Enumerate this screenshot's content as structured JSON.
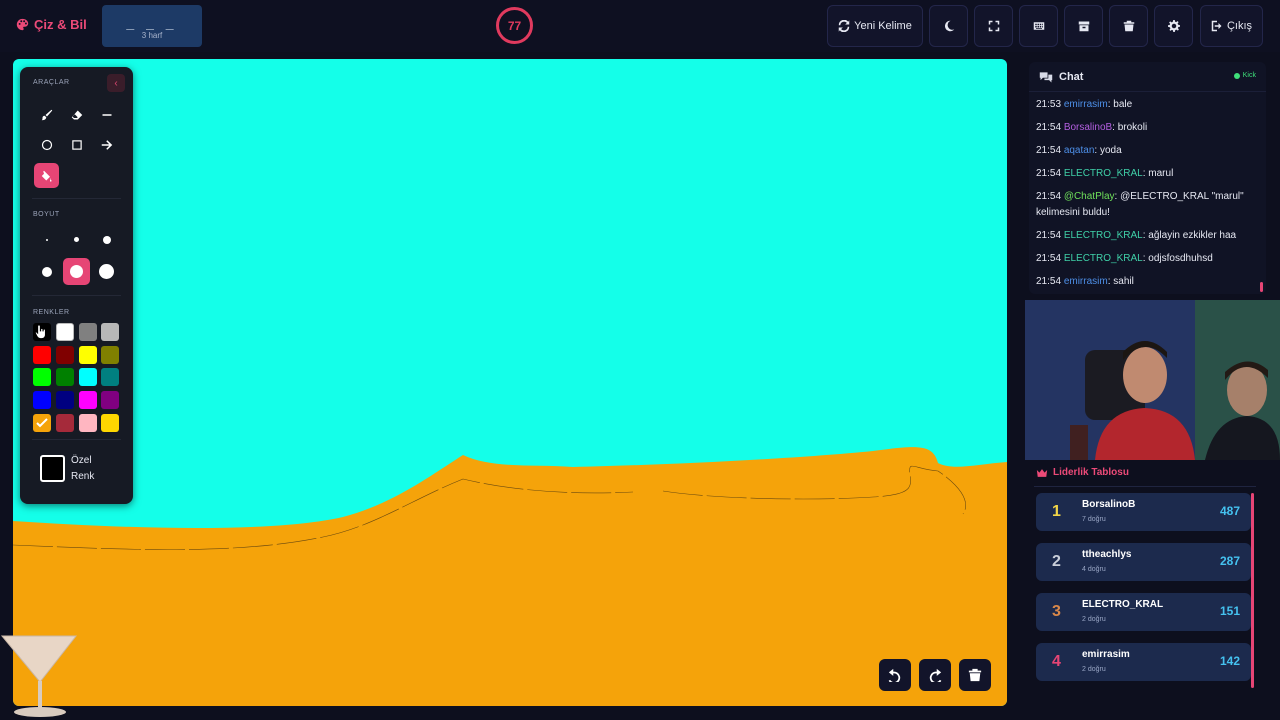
{
  "app": {
    "title": "Çiz & Bil"
  },
  "word": {
    "blanks": "_ _ _",
    "hint": "3 harf"
  },
  "timer": {
    "value": "77"
  },
  "toolbar": {
    "new_word_label": "Yeni Kelime",
    "exit_label": "Çıkış",
    "icons": [
      "refresh-icon",
      "moon-icon",
      "fullscreen-icon",
      "keyboard-icon",
      "archive-icon",
      "trash-icon",
      "gear-icon",
      "logout-icon"
    ]
  },
  "tools_panel": {
    "tools_title": "ARAÇLAR",
    "size_title": "BOYUT",
    "colors_title": "RENKLER",
    "custom_color_line1": "Özel",
    "custom_color_line2": "Renk",
    "active_tool": "fill",
    "active_size_index": 4,
    "selected_color": "#f5a30a",
    "colors": [
      "#000000",
      "#ffffff",
      "#808080",
      "#b8b8b8",
      "#ff0000",
      "#800000",
      "#ffff00",
      "#808000",
      "#00ff00",
      "#008000",
      "#00ffff",
      "#008080",
      "#0000ff",
      "#000080",
      "#ff00ff",
      "#800080",
      "#f5a30a",
      "#a52a3a",
      "#ffb6c1",
      "#ffd700"
    ]
  },
  "canvas": {
    "background": "#14ffe9",
    "fill_color": "#f5a30a"
  },
  "chat": {
    "title": "Chat",
    "source": "Kick",
    "messages": [
      {
        "time": "21:53",
        "user": "emirrasim",
        "user_color": "#4d8fe8",
        "text": ": bale"
      },
      {
        "time": "21:54",
        "user": "BorsalinoB",
        "user_color": "#b35fe0",
        "text": ": brokoli"
      },
      {
        "time": "21:54",
        "user": "aqatan",
        "user_color": "#4d8fe8",
        "text": ": yoda"
      },
      {
        "time": "21:54",
        "user": "ELECTRO_KRAL",
        "user_color": "#3fd0a8",
        "text": ": marul"
      },
      {
        "time": "21:54",
        "user": "@ChatPlay",
        "user_color": "#6fe05a",
        "text": ": @ELECTRO_KRAL \"marul\" kelimesini buldu!"
      },
      {
        "time": "21:54",
        "user": "ELECTRO_KRAL",
        "user_color": "#3fd0a8",
        "text": ": ağlayin ezkikler haa"
      },
      {
        "time": "21:54",
        "user": "ELECTRO_KRAL",
        "user_color": "#3fd0a8",
        "text": ": odjsfosdhuhsd"
      },
      {
        "time": "21:54",
        "user": "emirrasim",
        "user_color": "#4d8fe8",
        "text": ": sahil"
      }
    ]
  },
  "leaderboard": {
    "title": "Liderlik Tablosu",
    "players": [
      {
        "rank": "1",
        "name": "BorsalinoB",
        "guesses": "7 doğru",
        "score": "487",
        "rank_color": "#f2d548"
      },
      {
        "rank": "2",
        "name": "ttheachlys",
        "guesses": "4 doğru",
        "score": "287",
        "rank_color": "#c9ced9"
      },
      {
        "rank": "3",
        "name": "ELECTRO_KRAL",
        "guesses": "2 doğru",
        "score": "151",
        "rank_color": "#d9884a"
      },
      {
        "rank": "4",
        "name": "emirrasim",
        "guesses": "2 doğru",
        "score": "142",
        "rank_color": "#e64575"
      }
    ]
  }
}
